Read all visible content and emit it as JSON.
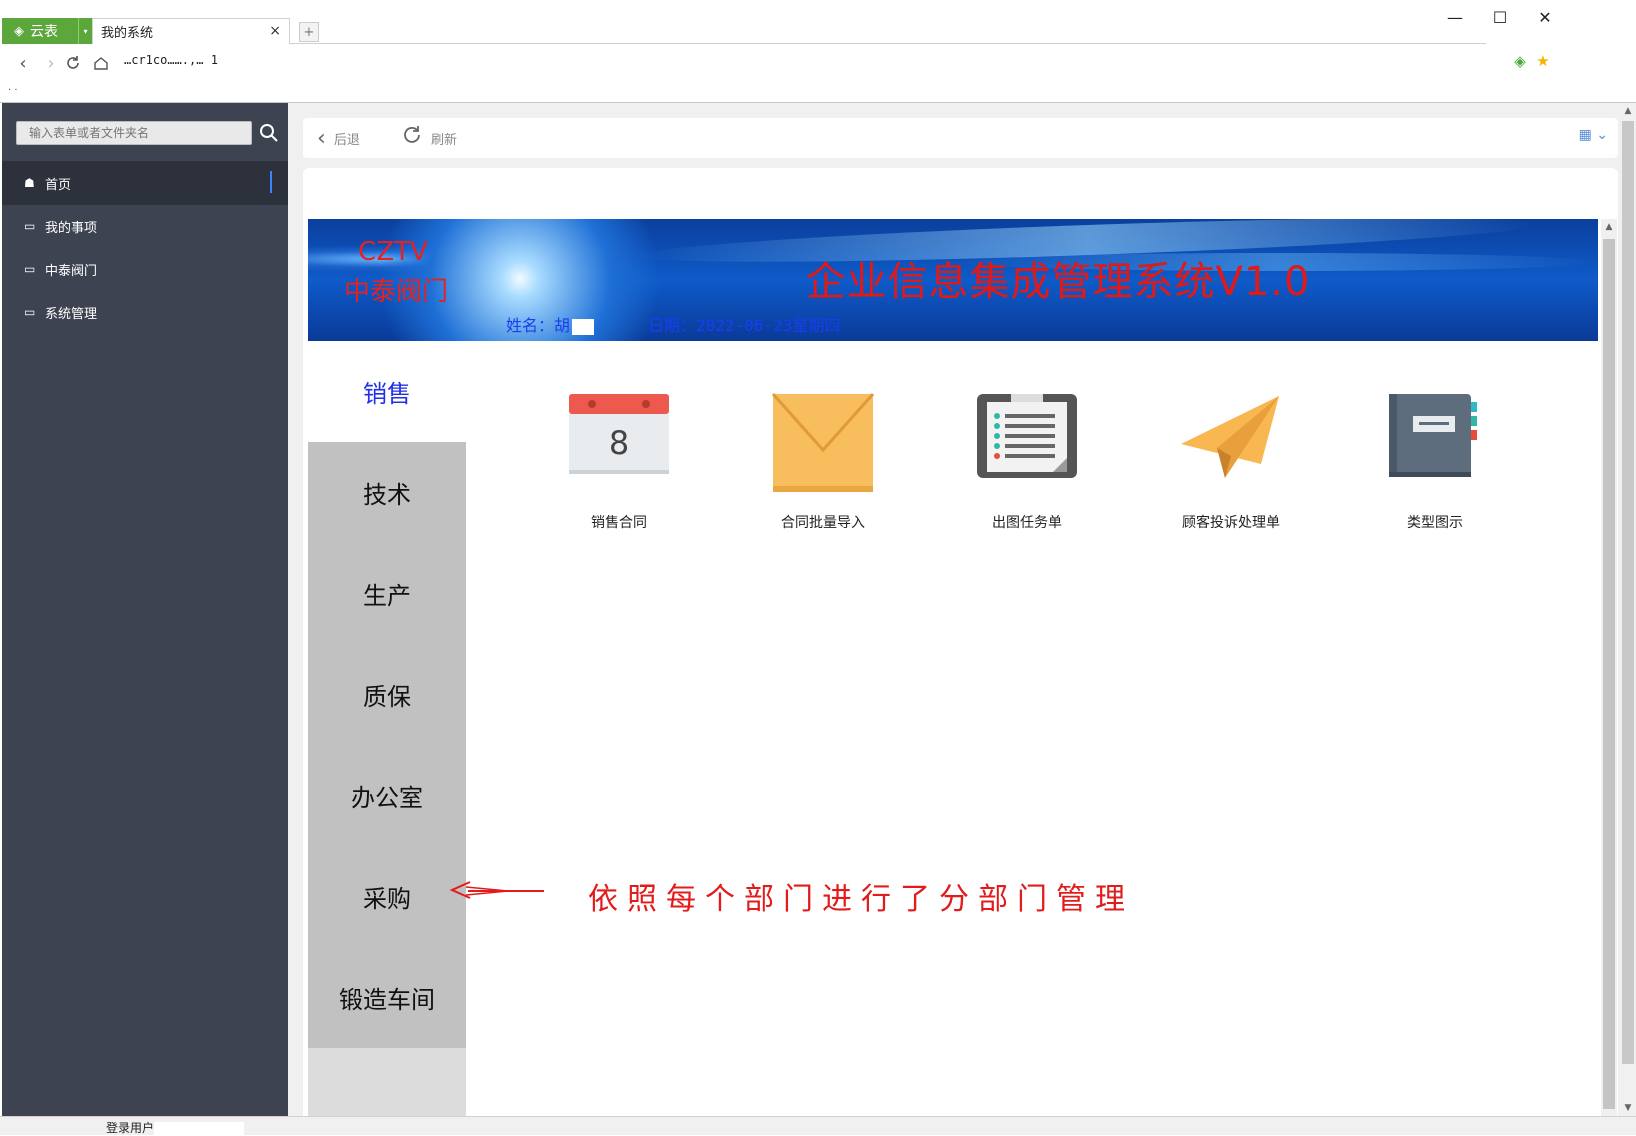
{
  "browser": {
    "brand_label": "云表",
    "tab_title": "我的系统",
    "tab_close": "×",
    "new_tab": "+",
    "address": "…cr1co…….,…  1",
    "dots": ". ."
  },
  "sidebar": {
    "search_placeholder": "输入表单或者文件夹名",
    "items": [
      {
        "label": "首页",
        "icon": "home-icon"
      },
      {
        "label": "我的事项",
        "icon": "folder-open-icon"
      },
      {
        "label": "中泰阀门",
        "icon": "folder-open-icon"
      },
      {
        "label": "系统管理",
        "icon": "folder-open-icon"
      }
    ]
  },
  "toolbar": {
    "back_label": "后退",
    "refresh_label": "刷新"
  },
  "banner": {
    "logo_line1": "CZTV",
    "logo_line2": "中泰阀门",
    "title": "企业信息集成管理系统V1.0",
    "name_label": "姓名：胡",
    "date_label": "日期：2022-06-23星期四"
  },
  "departments": {
    "active": "销售",
    "tabs": [
      "销售",
      "技术",
      "生产",
      "质保",
      "办公室",
      "采购",
      "锻造车间"
    ]
  },
  "modules": [
    {
      "label": "销售合同",
      "icon": "calendar-icon",
      "calendar_day": "8"
    },
    {
      "label": "合同批量导入",
      "icon": "envelope-icon"
    },
    {
      "label": "出图任务单",
      "icon": "clipboard-icon"
    },
    {
      "label": "顾客投诉处理单",
      "icon": "paper-plane-icon"
    },
    {
      "label": "类型图示",
      "icon": "book-icon"
    }
  ],
  "annotation": {
    "text": "依照每个部门进行了分部门管理"
  },
  "status": {
    "label": "登录用户"
  },
  "colors": {
    "sidebar_bg": "#3d4351",
    "brand_green": "#5ba73c",
    "banner_title_red": "#e01919",
    "active_dept_blue": "#2030e6",
    "annotation_red": "#e21c1c"
  }
}
